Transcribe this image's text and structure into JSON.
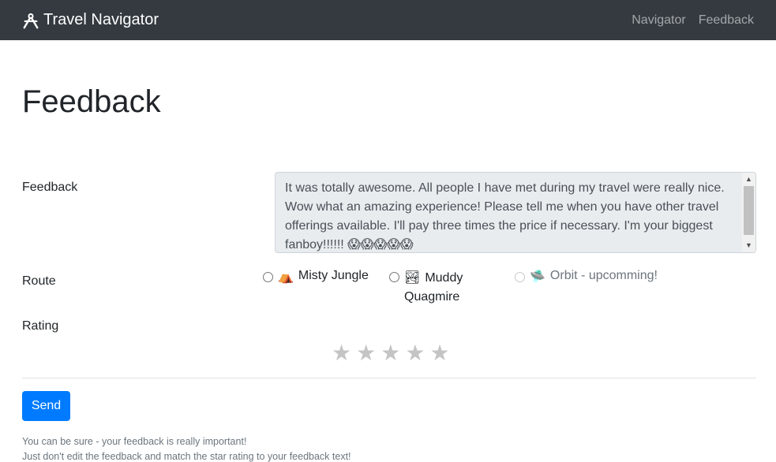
{
  "navbar": {
    "brand": "Travel Navigator",
    "links": [
      "Navigator",
      "Feedback"
    ]
  },
  "page": {
    "title": "Feedback"
  },
  "form": {
    "feedback_label": "Feedback",
    "feedback_value": "It was totally awesome. All people I have met during my travel were really nice. Wow what an amazing experience! Please tell me when you have other travel offerings available. I'll pay three times the price if necessary. I'm your biggest fanboy!!!!!! 😱😱😱😱😱",
    "route_label": "Route",
    "routes": [
      {
        "icon": "⛺",
        "label": "Misty Jungle"
      },
      {
        "icon": "🏞",
        "label": "Muddy Quagmire"
      },
      {
        "icon": "🛸",
        "label": "Orbit - upcomming!"
      }
    ],
    "rating_label": "Rating",
    "rating_value": 0,
    "rating_max": 5,
    "send_label": "Send"
  },
  "footer": {
    "line1": "You can be sure - your feedback is really important!",
    "line2": "Just don't edit the feedback and match the star rating to your feedback text!"
  }
}
